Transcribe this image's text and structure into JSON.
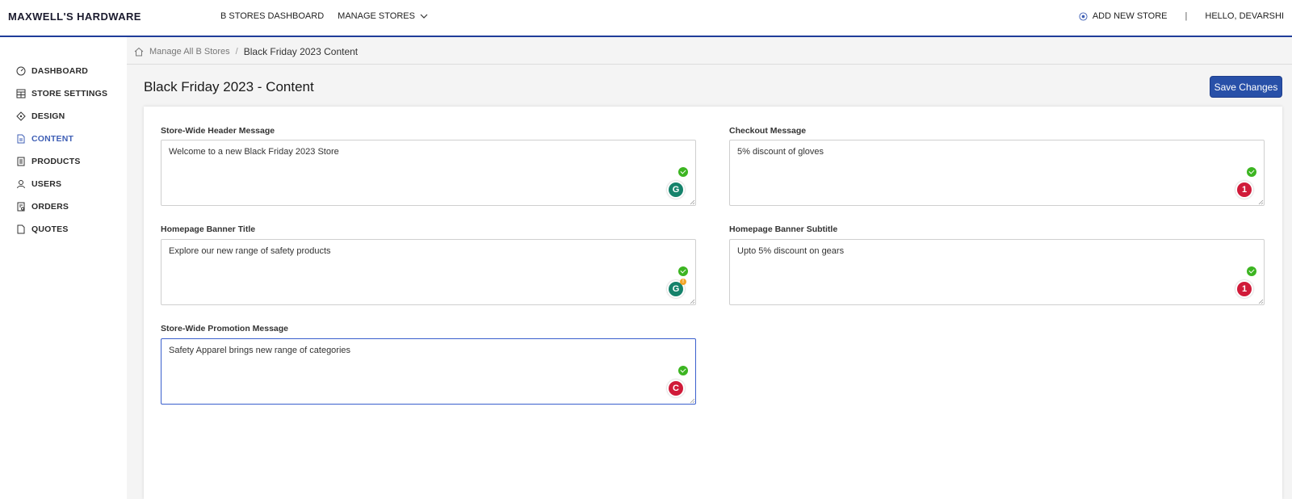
{
  "app": {
    "brand": "MAXWELL'S HARDWARE"
  },
  "topnav": {
    "dashboard": "B STORES DASHBOARD",
    "manage": "MANAGE STORES",
    "add_store": "ADD NEW STORE",
    "separator": "|",
    "greeting": "HELLO, DEVARSHI"
  },
  "sidebar": {
    "items": [
      {
        "label": "DASHBOARD",
        "icon": "gauge-icon"
      },
      {
        "label": "STORE SETTINGS",
        "icon": "layout-icon"
      },
      {
        "label": "DESIGN",
        "icon": "diamond-icon"
      },
      {
        "label": "CONTENT",
        "icon": "document-icon"
      },
      {
        "label": "PRODUCTS",
        "icon": "list-icon"
      },
      {
        "label": "USERS",
        "icon": "user-icon"
      },
      {
        "label": "ORDERS",
        "icon": "orders-icon"
      },
      {
        "label": "QUOTES",
        "icon": "file-icon"
      }
    ],
    "active": "CONTENT"
  },
  "breadcrumb": {
    "parent": "Manage All B Stores",
    "separator": "/",
    "current": "Black Friday 2023 Content"
  },
  "page": {
    "title": "Black Friday 2023 - Content",
    "save_label": "Save Changes"
  },
  "fields": {
    "header_message": {
      "label": "Store-Wide Header Message",
      "value": "Welcome to a new Black Friday 2023 Store",
      "badge": "G"
    },
    "checkout_message": {
      "label": "Checkout Message",
      "value": "5% discount of gloves",
      "badge": "1"
    },
    "banner_title": {
      "label": "Homepage Banner Title",
      "value": "Explore our new range of safety products",
      "badge": "G",
      "badge_alert": "!"
    },
    "banner_subtitle": {
      "label": "Homepage Banner Subtitle",
      "value": "Upto 5% discount on gears",
      "badge": "1"
    },
    "promotion_message": {
      "label": "Store-Wide Promotion Message",
      "value": "Safety Apparel brings new range of categories",
      "badge": "C"
    }
  },
  "colors": {
    "accent": "#2850a8",
    "active_nav": "#3f5fb5",
    "grammarly_green": "#15826b",
    "grammarly_red": "#d01a39",
    "check_green": "#3cb521"
  }
}
